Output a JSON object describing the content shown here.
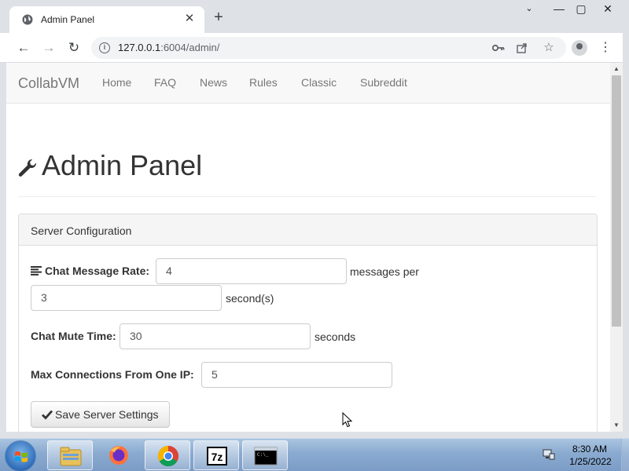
{
  "browser": {
    "tab_title": "Admin Panel",
    "tab_close": "✕",
    "new_tab": "+",
    "url_host": "127.0.0.1",
    "url_rest": ":6004/admin/",
    "window_min": "—",
    "window_max": "▢",
    "window_close": "✕",
    "tab_search": "⌄"
  },
  "navbar": {
    "brand": "CollabVM",
    "links": [
      "Home",
      "FAQ",
      "News",
      "Rules",
      "Classic",
      "Subreddit"
    ]
  },
  "page": {
    "title": "Admin Panel"
  },
  "panel": {
    "heading": "Server Configuration",
    "chat_rate_label": "Chat Message Rate:",
    "chat_rate_messages": "4",
    "messages_per_text": "messages per",
    "chat_rate_seconds": "3",
    "seconds_paren_text": "second(s)",
    "mute_label": "Chat Mute Time:",
    "mute_value": "30",
    "mute_unit": "seconds",
    "max_conn_label": "Max Connections From One IP:",
    "max_conn_value": "5",
    "save_button": "Save Server Settings"
  },
  "taskbar": {
    "apps": [
      "explorer-icon",
      "firefox-icon",
      "chrome-icon",
      "7zip-icon",
      "cmd-icon"
    ],
    "time": "8:30 AM",
    "date": "1/25/2022"
  },
  "colors": {
    "chrome_frame": "#dee1e6",
    "navbar_bg": "#f8f8f8",
    "panel_heading_bg": "#f5f5f5",
    "text": "#333333",
    "nav_text": "#777777"
  }
}
